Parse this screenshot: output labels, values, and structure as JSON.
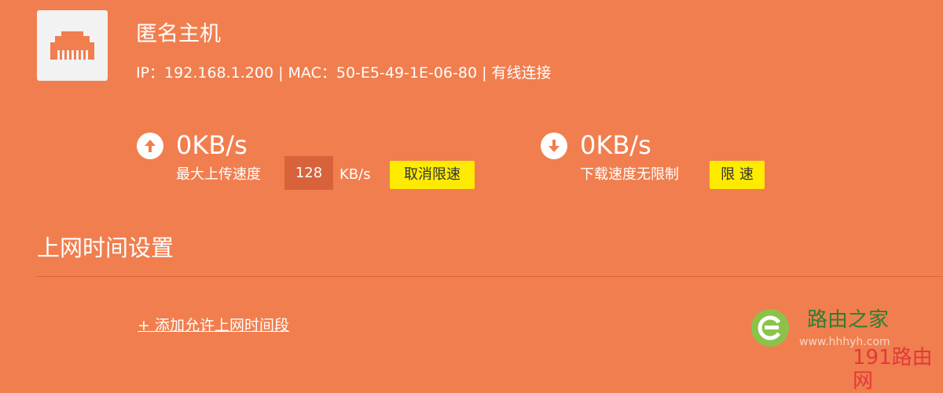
{
  "device": {
    "name": "匿名主机",
    "info": "IP：192.168.1.200 | MAC：50-E5-49-1E-06-80 | 有线连接",
    "icon": "ethernet-port-icon"
  },
  "upload": {
    "icon": "arrow-up-icon",
    "speed": "0KB/s",
    "label": "最大上传速度",
    "limit_value": "128",
    "unit": "KB/s",
    "button": "取消限速"
  },
  "download": {
    "icon": "arrow-down-icon",
    "speed": "0KB/s",
    "label": "下载速度无限制",
    "button": "限 速"
  },
  "schedule": {
    "title": "上网时间设置",
    "add_link": "+ 添加允许上网时间段"
  },
  "watermark": {
    "title": "路由之家",
    "url": "www.hhhyh.com",
    "site": "191路由网"
  },
  "colors": {
    "background": "#F17E4E",
    "button": "#FFEB00",
    "input": "#D8623A"
  }
}
